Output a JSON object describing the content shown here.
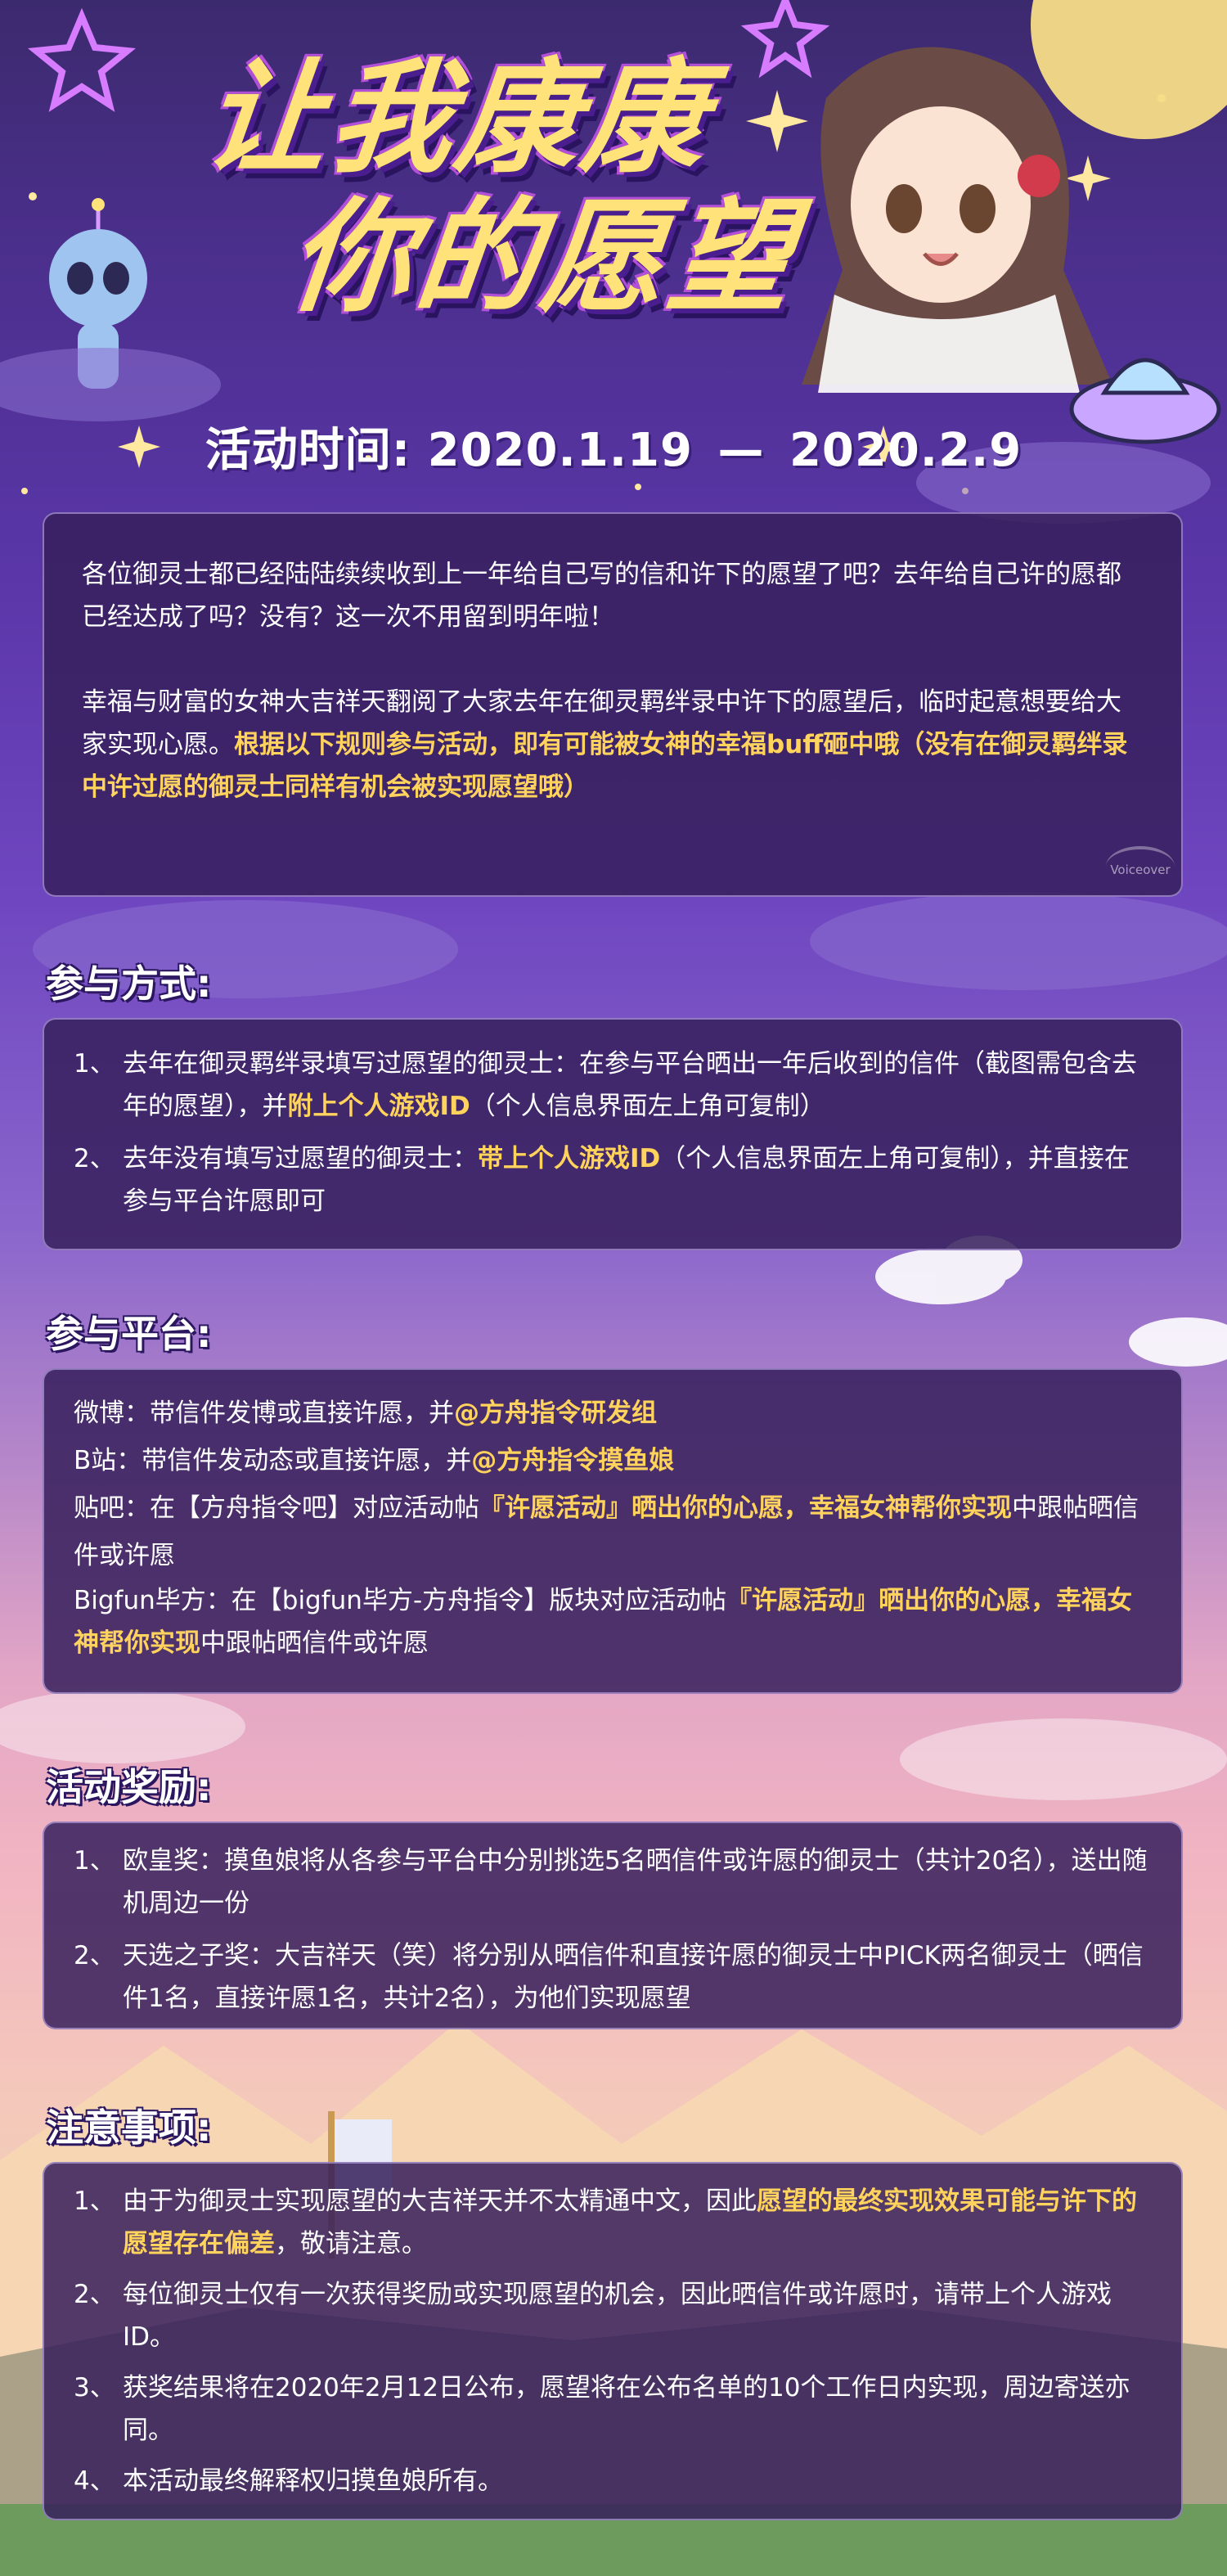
{
  "header": {
    "title_line1": "让我康康",
    "title_line2": "你的愿望",
    "time_label": "活动时间:",
    "time_start": "2020.1.19",
    "time_sep": "—",
    "time_end": "2020.2.9"
  },
  "intro": {
    "p1": "各位御灵士都已经陆陆续续收到上一年给自己写的信和许下的愿望了吧？去年给自己许的愿都已经达成了吗？没有？这一次不用留到明年啦！",
    "p2_plain": "幸福与财富的女神大吉祥天翻阅了大家去年在御灵羁绊录中许下的愿望后，临时起意想要给大家实现心愿。",
    "p2_highlight": "根据以下规则参与活动，即有可能被女神的幸福buff砸中哦（没有在御灵羁绊录中许过愿的御灵士同样有机会被实现愿望哦）",
    "watermark": "Voiceover"
  },
  "join": {
    "title": "参与方式:",
    "items": [
      {
        "num": "1、",
        "plain_a": "去年在御灵羁绊录填写过愿望的御灵士：在参与平台晒出一年后收到的信件（截图需包含去年的愿望），并",
        "highlight": "附上个人游戏ID",
        "plain_b": "（个人信息界面左上角可复制）"
      },
      {
        "num": "2、",
        "plain_a": "去年没有填写过愿望的御灵士：",
        "highlight": "带上个人游戏ID",
        "plain_b": "（个人信息界面左上角可复制），并直接在参与平台许愿即可"
      }
    ]
  },
  "platform": {
    "title": "参与平台:",
    "weibo_plain": "微博：带信件发博或直接许愿，并",
    "weibo_hl": "@方舟指令研发组",
    "bili_plain": "B站：带信件发动态或直接许愿，并",
    "bili_hl": "@方舟指令摸鱼娘",
    "tieba_plain": "贴吧：在【方舟指令吧】对应活动帖",
    "tieba_hl": "『许愿活动』晒出你的心愿，幸福女神帮你实现",
    "tieba_tail": "中跟帖晒信件或许愿",
    "bigfun_plain": "Bigfun毕方：在【bigfun毕方-方舟指令】版块对应活动帖",
    "bigfun_hl": "『许愿活动』晒出你的心愿，幸福女神帮你实现",
    "bigfun_tail": "中跟帖晒信件或许愿"
  },
  "reward": {
    "title": "活动奖励:",
    "items": [
      {
        "num": "1、",
        "text": "欧皇奖：摸鱼娘将从各参与平台中分别挑选5名晒信件或许愿的御灵士（共计20名），送出随机周边一份"
      },
      {
        "num": "2、",
        "text": "天选之子奖：大吉祥天（笑）将分别从晒信件和直接许愿的御灵士中PICK两名御灵士（晒信件1名，直接许愿1名，共计2名），为他们实现愿望"
      }
    ]
  },
  "notice": {
    "title": "注意事项:",
    "item1_num": "1、",
    "item1_plain": "由于为御灵士实现愿望的大吉祥天并不太精通中文，因此",
    "item1_hl": "愿望的最终实现效果可能与许下的愿望存在偏差",
    "item1_tail": "，敬请注意。",
    "items": [
      {
        "num": "2、",
        "text": "每位御灵士仅有一次获得奖励或实现愿望的机会，因此晒信件或许愿时，请带上个人游戏ID。"
      },
      {
        "num": "3、",
        "text": "获奖结果将在2020年2月12日公布，愿望将在公布名单的10个工作日内实现，周边寄送亦同。"
      },
      {
        "num": "4、",
        "text": "本活动最终解释权归摸鱼娘所有。"
      }
    ]
  },
  "colors": {
    "highlight": "#ffd35c",
    "title_yellow": "#ffe27a",
    "panel_bg": "#37205c"
  }
}
